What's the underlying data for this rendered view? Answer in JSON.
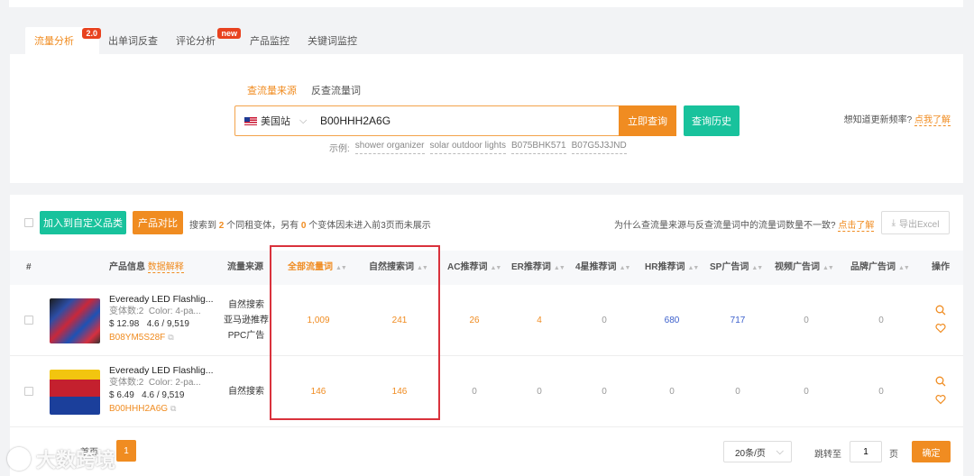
{
  "tabs": [
    {
      "label": "流量分析",
      "badge": "2.0"
    },
    {
      "label": "出单词反查",
      "badge": ""
    },
    {
      "label": "评论分析",
      "badge": "new"
    },
    {
      "label": "产品监控",
      "badge": ""
    },
    {
      "label": "关键词监控",
      "badge": ""
    }
  ],
  "search": {
    "mode_tabs": [
      "查流量来源",
      "反查流量词"
    ],
    "site": "美国站",
    "value": "B00HHH2A6G",
    "query_button": "立即查询",
    "history_button": "查询历史",
    "examples_label": "示例:",
    "examples": [
      "shower organizer",
      "solar outdoor lights",
      "B075BHK571",
      "B07G5J3JND"
    ],
    "freq_text": "想知道更新频率?",
    "freq_link": "点我了解"
  },
  "toolbar": {
    "add_category": "加入到自定义品类",
    "compare": "产品对比",
    "summary_pre": "搜索到",
    "found": "2",
    "summary_mid": "个同租变体，另有",
    "hidden": "0",
    "summary_post": "个变体因未进入前3页而未展示",
    "why_text": "为什么查流量来源与反查流量词中的流量词数量不一致?",
    "why_link": "点击了解",
    "export": "导出Excel"
  },
  "table": {
    "headers": {
      "index": "#",
      "product": "产品信息",
      "product_link": "数据解释",
      "source": "流量来源",
      "all_words": "全部流量词",
      "natural": "自然搜索词",
      "ac": "AC推荐词",
      "er": "ER推荐词",
      "four_star": "4星推荐词",
      "hr": "HR推荐词",
      "sp": "SP广告词",
      "video": "视频广告词",
      "brand": "品牌广告词",
      "ops": "操作"
    },
    "rows": [
      {
        "name": "Eveready LED Flashlig...",
        "variants": "变体数:2",
        "color": "Color: 4-pa...",
        "price": "$ 12.98",
        "rating": "4.6 / 9,519",
        "asin": "B08YM5S28F",
        "sources": [
          "自然搜索",
          "亚马逊推荐",
          "PPC广告"
        ],
        "all": "1,009",
        "natural": "241",
        "ac": "26",
        "er": "4",
        "four_star": "0",
        "hr": "680",
        "sp": "717",
        "video": "0",
        "brand": "0"
      },
      {
        "name": "Eveready LED Flashlig...",
        "variants": "变体数:2",
        "color": "Color: 2-pa...",
        "price": "$ 6.49",
        "rating": "4.6 / 9,519",
        "asin": "B00HHH2A6G",
        "sources": [
          "自然搜索"
        ],
        "all": "146",
        "natural": "146",
        "ac": "0",
        "er": "0",
        "four_star": "0",
        "hr": "0",
        "sp": "0",
        "video": "0",
        "brand": "0"
      }
    ]
  },
  "pager": {
    "first": "首页",
    "current": "1",
    "per_page": "20条/页",
    "goto_label": "跳转至",
    "goto_value": "1",
    "unit": "页",
    "confirm": "确定"
  },
  "watermark": "大数跨境",
  "colors": {
    "accent": "#f08c21",
    "green": "#18c29c",
    "highlight": "#d9323c",
    "link_blue": "#3b5fcc"
  }
}
